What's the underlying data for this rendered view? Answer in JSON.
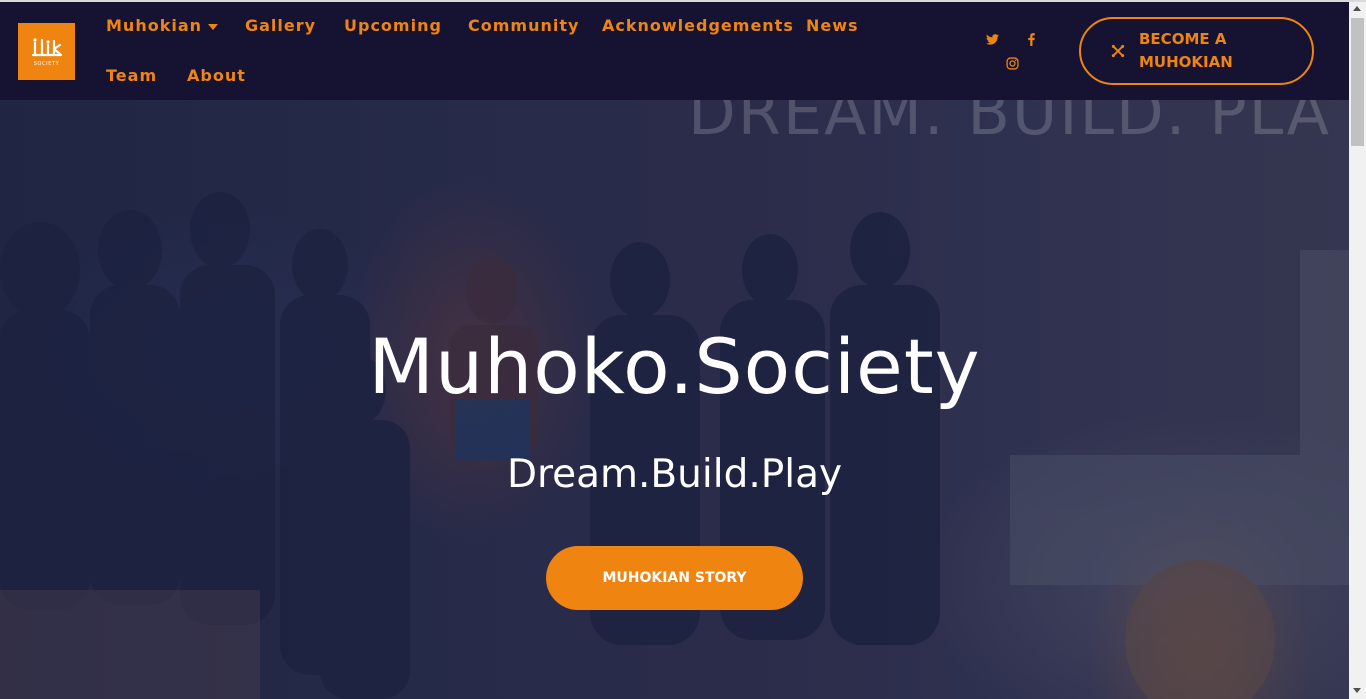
{
  "brand": {
    "logo_text": "SOCIETY",
    "accent_color": "#ef8411",
    "nav_bg_color": "#151331"
  },
  "nav": {
    "items": [
      {
        "label": "Muhokian",
        "has_dropdown": true
      },
      {
        "label": "Gallery"
      },
      {
        "label": "Upcoming"
      },
      {
        "label": "Community"
      },
      {
        "label": "Acknowledgements"
      },
      {
        "label": "News"
      },
      {
        "label": "Team"
      },
      {
        "label": "About"
      }
    ]
  },
  "social": [
    "twitter-icon",
    "facebook-icon",
    "instagram-icon"
  ],
  "cta": {
    "label": "BECOME A MUHOKIAN",
    "icon": "joomla-icon"
  },
  "hero": {
    "background_text": "DREAM. BUILD. PLA",
    "title": "Muhoko.Society",
    "subtitle": "Dream.Build.Play",
    "button_label": "MUHOKIAN STORY"
  }
}
